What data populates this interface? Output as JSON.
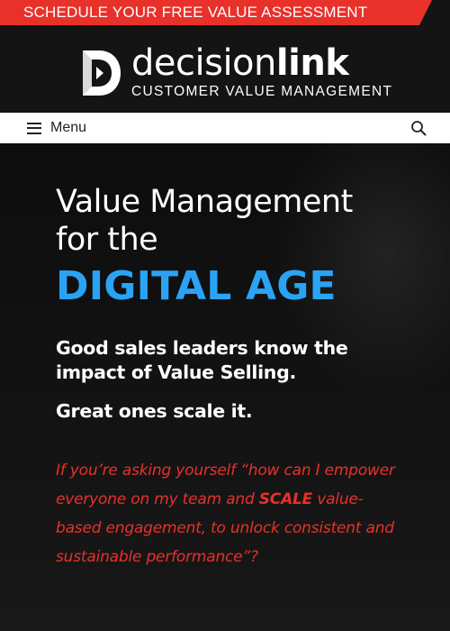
{
  "promo": {
    "label": "SCHEDULE YOUR FREE VALUE ASSESSMENT",
    "color": "#e8312a"
  },
  "logo": {
    "name_regular": "decision",
    "name_bold": "link",
    "tagline": "CUSTOMER VALUE MANAGEMENT",
    "icon": "decisionlink-d-logo-icon"
  },
  "nav": {
    "menu_label": "Menu",
    "menu_icon": "hamburger-icon",
    "search_icon": "search-icon"
  },
  "hero": {
    "headline_line1": "Value Management",
    "headline_line2": "for the",
    "headline_accent": "DIGITAL AGE",
    "accent_color": "#2aa3f5",
    "lead": "Good sales leaders know the impact of Value Selling.",
    "lead2": "Great ones scale it.",
    "question_part1": "If you’re asking yourself “how can I empower everyone on my team and ",
    "question_emphasis": "SCALE",
    "question_part2": " value-based engagement, to unlock consistent and sustainable performance”?",
    "question_color": "#e8312a"
  }
}
